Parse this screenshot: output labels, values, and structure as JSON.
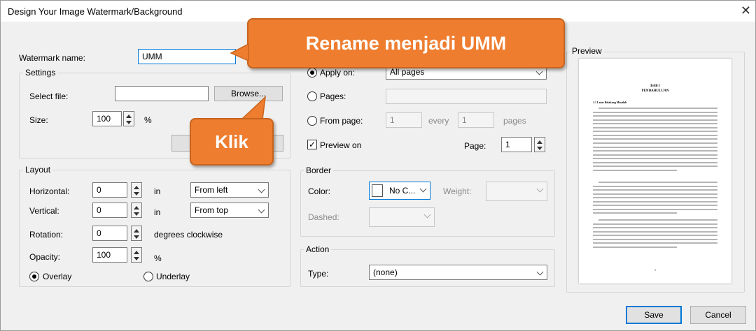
{
  "window": {
    "title": "Design Your Image Watermark/Background",
    "close_glyph": "✕"
  },
  "watermark": {
    "label": "Watermark name:",
    "value": "UMM"
  },
  "settings": {
    "title": "Settings",
    "select_file_label": "Select file:",
    "file_value": "",
    "browse_label": "Browse...",
    "size_label": "Size:",
    "size_value": "100",
    "size_unit": "%"
  },
  "layout": {
    "title": "Layout",
    "horizontal_label": "Horizontal:",
    "horizontal_value": "0",
    "horizontal_unit": "in",
    "horizontal_from": "From left",
    "vertical_label": "Vertical:",
    "vertical_value": "0",
    "vertical_unit": "in",
    "vertical_from": "From top",
    "rotation_label": "Rotation:",
    "rotation_value": "0",
    "rotation_unit": "degrees clockwise",
    "opacity_label": "Opacity:",
    "opacity_value": "100",
    "opacity_unit": "%",
    "overlay_label": "Overlay",
    "underlay_label": "Underlay",
    "selected": "overlay"
  },
  "pages": {
    "apply_on_label": "Apply on:",
    "apply_on_value": "All pages",
    "pages_label": "Pages:",
    "pages_value": "",
    "from_page_label": "From page:",
    "from_page_value": "1",
    "every_label": "every",
    "every_value": "1",
    "pages_unit": "pages",
    "preview_on_label": "Preview on",
    "preview_on_checked": true,
    "page_label": "Page:",
    "page_value": "1"
  },
  "border": {
    "title": "Border",
    "color_label": "Color:",
    "color_value": "No C...",
    "weight_label": "Weight:",
    "weight_value": "",
    "dashed_label": "Dashed:",
    "dashed_value": ""
  },
  "action": {
    "title": "Action",
    "type_label": "Type:",
    "type_value": "(none)"
  },
  "preview": {
    "title": "Preview",
    "chapter_heading": "BAB I",
    "chapter_title": "PENDAHULUAN",
    "section_heading": "1.1 Latar Belakang Masalah",
    "page_number": "1"
  },
  "buttons": {
    "save_label": "Save",
    "cancel_label": "Cancel"
  },
  "callouts": {
    "rename_text": "Rename menjadi UMM",
    "click_text": "Klik"
  },
  "colors": {
    "callout": "#ee7d2f",
    "accent": "#0078d7"
  }
}
